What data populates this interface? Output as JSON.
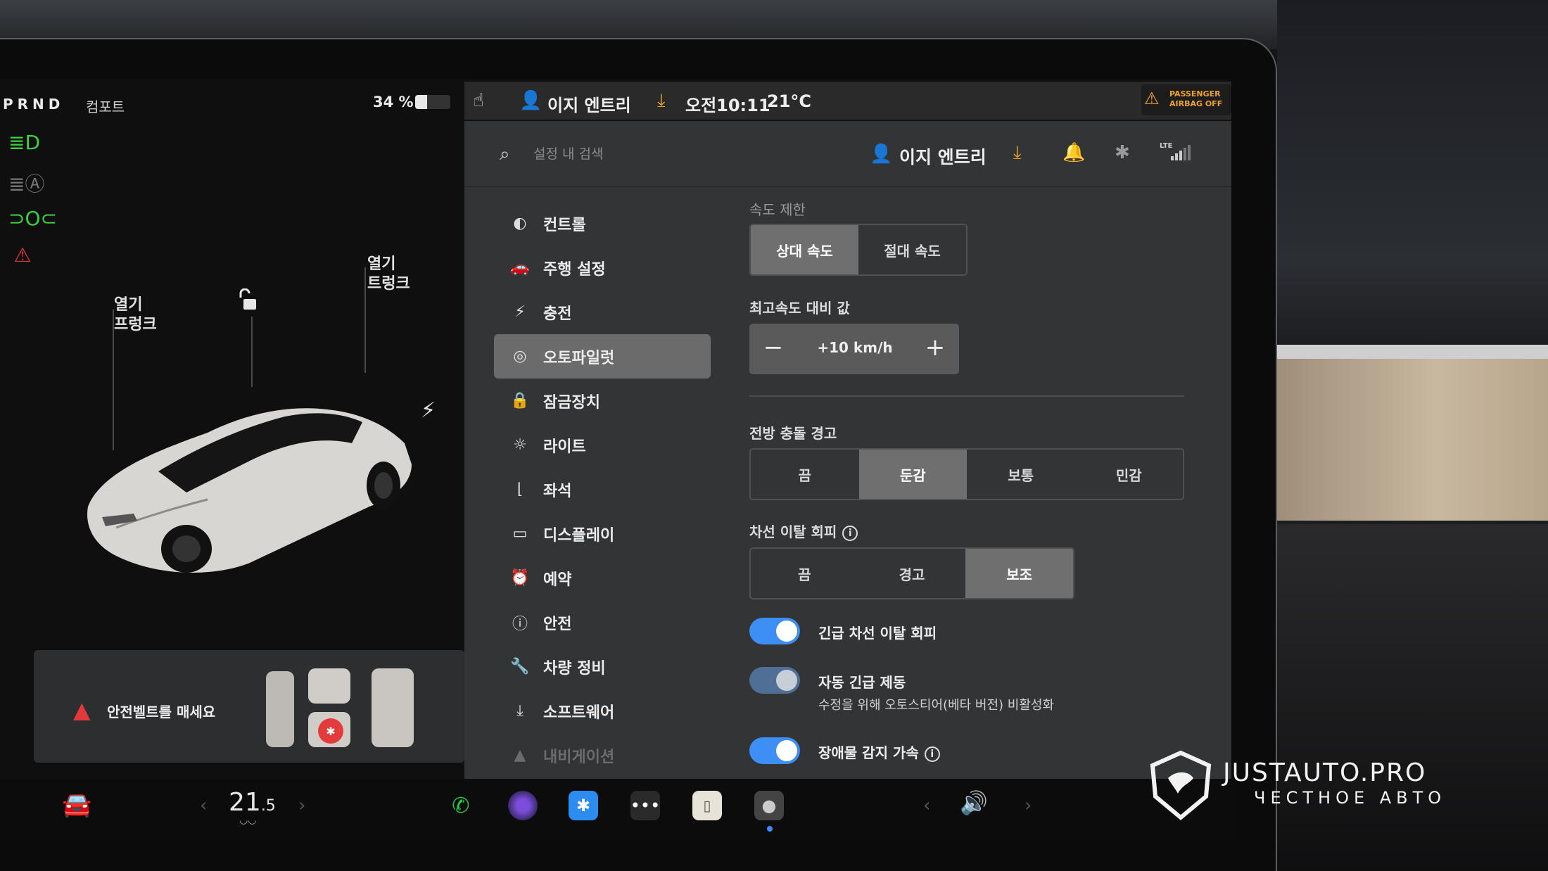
{
  "status": {
    "gear": "PRND",
    "drive_mode": "컴포트",
    "battery_pct_label": "34 %",
    "battery_level": 0.34
  },
  "left_panel": {
    "frunk_label_1": "열기",
    "frunk_label_2": "프렁크",
    "trunk_label_1": "열기",
    "trunk_label_2": "트렁크",
    "seatbelt_warning": "안전벨트를 매세요"
  },
  "topbar": {
    "driver_profile": "이지 엔트리",
    "time": "오전10:11",
    "temperature": "21°C",
    "airbag_line1": "PASSENGER",
    "airbag_line2": "AIRBAG OFF"
  },
  "settings_header": {
    "search_placeholder": "설정 내 검색",
    "profile": "이지 엔트리",
    "network": "LTE"
  },
  "nav": {
    "items": [
      {
        "label": "컨트롤",
        "icon": "toggle-icon"
      },
      {
        "label": "주행 설정",
        "icon": "car-icon"
      },
      {
        "label": "충전",
        "icon": "bolt-icon"
      },
      {
        "label": "오토파일럿",
        "icon": "steering-wheel-icon"
      },
      {
        "label": "잠금장치",
        "icon": "lock-icon"
      },
      {
        "label": "라이트",
        "icon": "light-icon"
      },
      {
        "label": "좌석",
        "icon": "seat-icon"
      },
      {
        "label": "디스플레이",
        "icon": "display-icon"
      },
      {
        "label": "예약",
        "icon": "alarm-icon"
      },
      {
        "label": "안전",
        "icon": "safety-icon"
      },
      {
        "label": "차량 정비",
        "icon": "wrench-icon"
      },
      {
        "label": "소프트웨어",
        "icon": "download-icon"
      },
      {
        "label": "내비게이션",
        "icon": "navigation-icon"
      }
    ],
    "active": "오토파일럿"
  },
  "autopilot": {
    "speed_limit": {
      "label": "속도 제한",
      "options": [
        "상대 속도",
        "절대 속도"
      ],
      "selected": "상대 속도"
    },
    "offset": {
      "label": "최고속도 대비 값",
      "value": "+10 km/h",
      "minus": "−",
      "plus": "+"
    },
    "forward_collision": {
      "label": "전방 충돌 경고",
      "options": [
        "끔",
        "둔감",
        "보통",
        "민감"
      ],
      "selected": "둔감"
    },
    "lane_departure": {
      "label": "차선 이탈 회피",
      "options": [
        "끔",
        "경고",
        "보조"
      ],
      "selected": "보조"
    },
    "toggles": {
      "emergency_lane": {
        "label": "긴급 차선 이탈 회피",
        "on": true
      },
      "auto_emergency_braking": {
        "label": "자동 긴급 제동",
        "sub": "수정을 위해 오토스티어(베타 버전) 비활성화",
        "on": true
      },
      "obstacle_accel": {
        "label": "장애물 감지 가속",
        "on": true
      }
    }
  },
  "bottom_bar": {
    "temp_whole": "21",
    "temp_fraction": ".5"
  },
  "watermark": {
    "title": "JUSTAUTO.PRO",
    "subtitle": "ЧЕСТНОЕ АВТО"
  },
  "colors": {
    "accent_blue": "#3d8ef5",
    "warning_red": "#e23a3a",
    "download_orange": "#f0a22b",
    "indicator_green": "#3ecf3e"
  }
}
